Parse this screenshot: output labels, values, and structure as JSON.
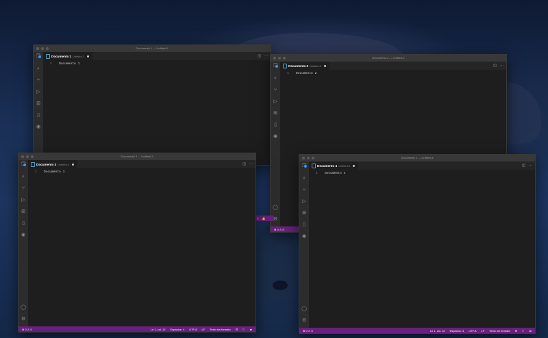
{
  "windows": [
    {
      "id": "w1",
      "title": "Documento 1 — Untitled-1",
      "tab_name": "Documento 1",
      "tab_path": "Untitled-1",
      "line_number": "1",
      "line_text": "Documento 1"
    },
    {
      "id": "w2",
      "title": "Documento 2 — Untitled-2",
      "tab_name": "Documento 2",
      "tab_path": "Untitled-2",
      "line_number": "1",
      "line_text": "Documento 2"
    },
    {
      "id": "w3",
      "title": "Documento 3 — Untitled-3",
      "tab_name": "Documento 3",
      "tab_path": "Untitled-3",
      "line_number": "1",
      "line_text": "Documento 3"
    },
    {
      "id": "w4",
      "title": "Documento 4 — Untitled-4",
      "tab_name": "Documento 4",
      "tab_path": "Untitled-4",
      "line_number": "1",
      "line_text": "Documento 4"
    }
  ],
  "statusbar": {
    "problems": "⊗ 0 ⚠ 0",
    "position": "Ln 1, col. 12",
    "spaces": "Espacios: 4",
    "encoding": "UTF-8",
    "eol": "LF",
    "language": "Texto sin formato"
  },
  "icons": [
    "explorer-icon",
    "search-icon",
    "source-control-icon",
    "run-debug-icon",
    "extensions-icon",
    "bookmarks-icon",
    "remote-icon",
    "account-icon",
    "settings-icon"
  ],
  "colors": {
    "statusbar": "#68217a",
    "editor": "#1e1e1e",
    "activity": "#2c2c2c"
  }
}
